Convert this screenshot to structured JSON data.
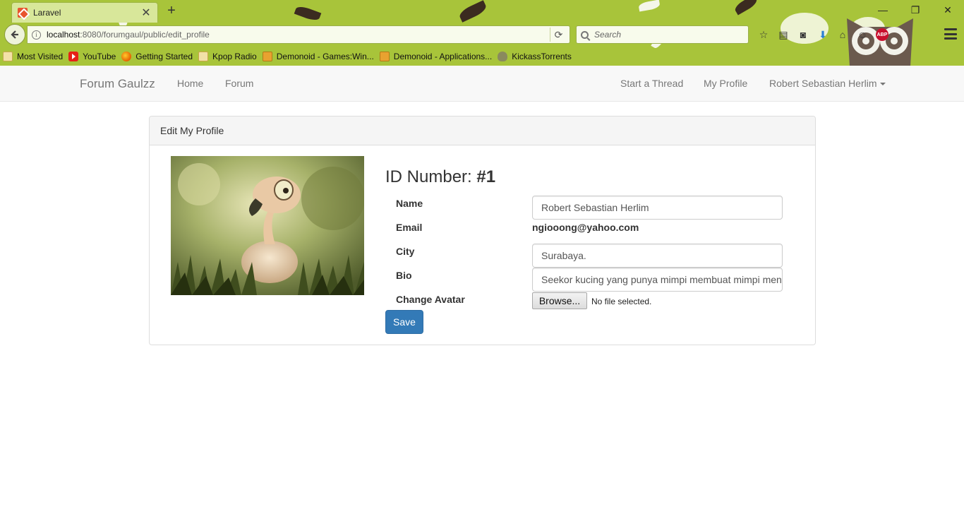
{
  "browser": {
    "tab_title": "Laravel",
    "tab_close": "✕",
    "new_tab": "+",
    "url_host": "localhost",
    "url_path": ":8080/forumgaul/public/edit_profile",
    "search_placeholder": "Search",
    "window_controls": {
      "minimize": "—",
      "restore": "❐",
      "close": "✕"
    },
    "bookmarks": [
      "Most Visited",
      "YouTube",
      "Getting Started",
      "Kpop Radio",
      "Demonoid - Games:Win...",
      "Demonoid - Applications...",
      "KickassTorrents"
    ],
    "theme_color": "#a8c43a"
  },
  "navbar": {
    "brand": "Forum Gaulzz",
    "left_links": [
      "Home",
      "Forum"
    ],
    "right_links": [
      "Start a Thread",
      "My Profile"
    ],
    "user_menu": "Robert Sebastian Herlim"
  },
  "panel": {
    "heading": "Edit My Profile",
    "id_label": "ID Number:",
    "id_value": "#1"
  },
  "form": {
    "name_label": "Name",
    "name_value": "Robert Sebastian Herlim",
    "email_label": "Email",
    "email_value": "ngiooong@yahoo.com",
    "city_label": "City",
    "city_value": "Surabaya.",
    "bio_label": "Bio",
    "bio_value": "Seekor kucing yang punya mimpi membuat mimpi men",
    "avatar_label": "Change Avatar",
    "browse_label": "Browse...",
    "file_status": "No file selected.",
    "save_label": "Save"
  },
  "colors": {
    "primary": "#337ab7",
    "navbar_bg": "#f8f8f8"
  }
}
